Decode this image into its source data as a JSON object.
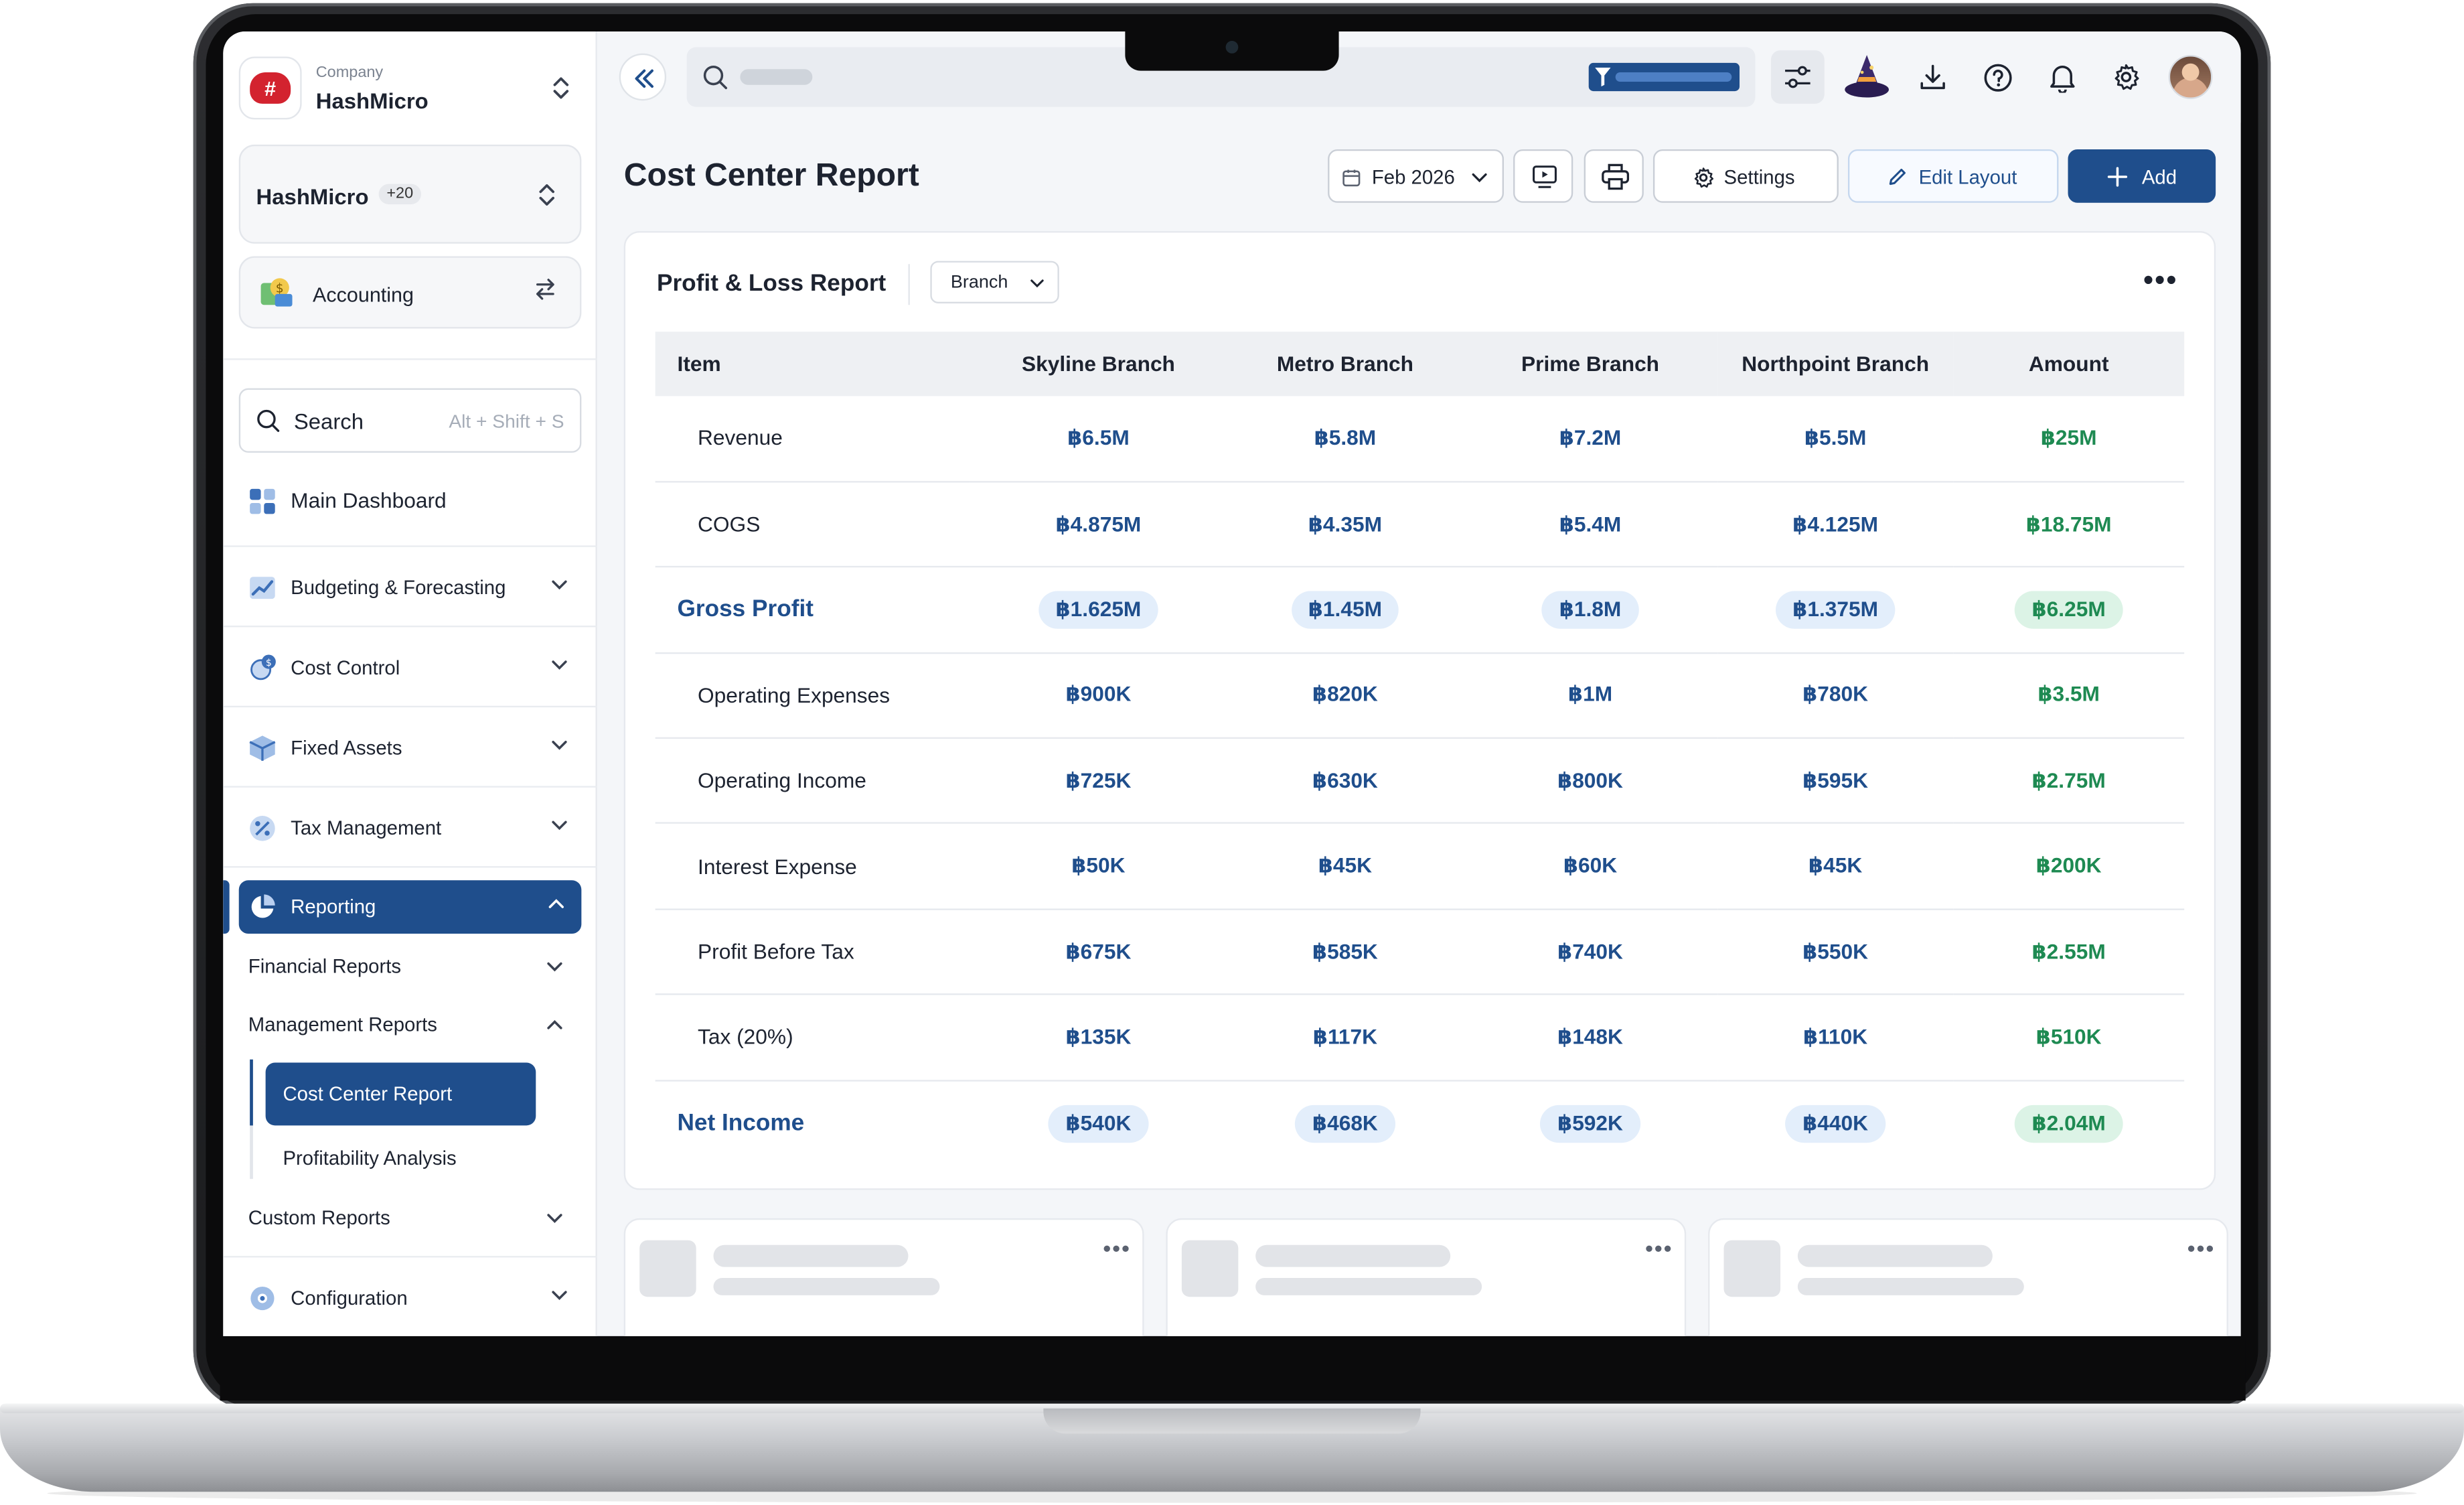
{
  "sidebar": {
    "company_label": "Company",
    "company_name": "HashMicro",
    "workspace": {
      "name": "HashMicro",
      "badge": "+20"
    },
    "module": "Accounting",
    "search": {
      "label": "Search",
      "shortcut": "Alt + Shift + S"
    },
    "items": [
      {
        "label": "Main Dashboard",
        "icon": "grid-icon"
      },
      {
        "label": "Budgeting & Forecasting",
        "icon": "chart-icon"
      },
      {
        "label": "Cost Control",
        "icon": "gear-coin-icon"
      },
      {
        "label": "Fixed Assets",
        "icon": "box-icon"
      },
      {
        "label": "Tax Management",
        "icon": "percent-icon"
      },
      {
        "label": "Reporting",
        "icon": "pie-chart-icon",
        "active": true
      },
      {
        "label": "Configuration",
        "icon": "gear-icon"
      }
    ],
    "reporting_sub": {
      "financial": "Financial Reports",
      "management": "Management Reports",
      "cost_center": "Cost Center Report",
      "profitability": "Profitability Analysis",
      "custom": "Custom Reports"
    }
  },
  "header": {
    "title": "Cost Center Report",
    "date": "Feb 2026",
    "settings": "Settings",
    "edit_layout": "Edit Layout",
    "add": "Add"
  },
  "report": {
    "title": "Profit & Loss Report",
    "filter": "Branch",
    "columns": [
      "Item",
      "Skyline Branch",
      "Metro Branch",
      "Prime Branch",
      "Northpoint Branch",
      "Amount"
    ],
    "rows": [
      {
        "item": "Revenue",
        "values": [
          "฿6.5M",
          "฿5.8M",
          "฿7.2M",
          "฿5.5M",
          "฿25M"
        ]
      },
      {
        "item": "COGS",
        "values": [
          "฿4.875M",
          "฿4.35M",
          "฿5.4M",
          "฿4.125M",
          "฿18.75M"
        ]
      },
      {
        "item": "Gross Profit",
        "values": [
          "฿1.625M",
          "฿1.45M",
          "฿1.8M",
          "฿1.375M",
          "฿6.25M"
        ]
      },
      {
        "item": "Operating Expenses",
        "values": [
          "฿900K",
          "฿820K",
          "฿1M",
          "฿780K",
          "฿3.5M"
        ]
      },
      {
        "item": "Operating Income",
        "values": [
          "฿725K",
          "฿630K",
          "฿800K",
          "฿595K",
          "฿2.75M"
        ]
      },
      {
        "item": "Interest Expense",
        "values": [
          "฿50K",
          "฿45K",
          "฿60K",
          "฿45K",
          "฿200K"
        ]
      },
      {
        "item": "Profit Before Tax",
        "values": [
          "฿675K",
          "฿585K",
          "฿740K",
          "฿550K",
          "฿2.55M"
        ]
      },
      {
        "item": "Tax (20%)",
        "values": [
          "฿135K",
          "฿117K",
          "฿148K",
          "฿110K",
          "฿510K"
        ]
      },
      {
        "item": "Net Income",
        "values": [
          "฿540K",
          "฿468K",
          "฿592K",
          "฿440K",
          "฿2.04M"
        ]
      }
    ]
  },
  "colors": {
    "primary": "#1f4e8c",
    "positive": "#1e8a52",
    "brand_red": "#d3232f"
  }
}
